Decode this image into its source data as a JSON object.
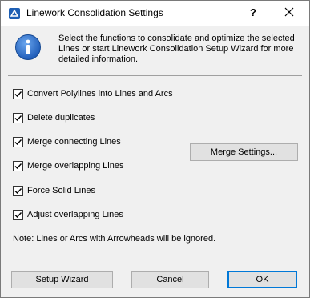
{
  "window": {
    "title": "Linework Consolidation Settings",
    "help_label": "?"
  },
  "info": {
    "message": "Select the functions to consolidate and optimize the selected Lines or start Linework Consolidation Setup Wizard for more detailed information."
  },
  "options": [
    {
      "label": "Convert Polylines into Lines and Arcs",
      "checked": true
    },
    {
      "label": "Delete duplicates",
      "checked": true
    },
    {
      "label": "Merge connecting Lines",
      "checked": true
    },
    {
      "label": "Merge overlapping Lines",
      "checked": true
    },
    {
      "label": "Force Solid Lines",
      "checked": true
    },
    {
      "label": "Adjust overlapping Lines",
      "checked": true
    }
  ],
  "buttons": {
    "merge_settings": "Merge Settings...",
    "setup_wizard": "Setup Wizard",
    "cancel": "Cancel",
    "ok": "OK"
  },
  "note": "Note: Lines or Arcs with Arrowheads will be ignored.",
  "colors": {
    "accent": "#0078d7",
    "info_icon": "#2a6cc2"
  }
}
